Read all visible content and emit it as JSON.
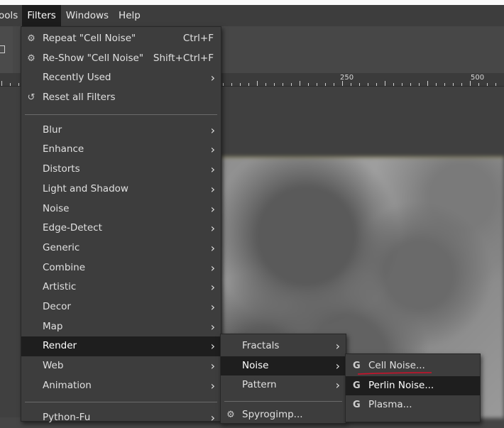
{
  "menubar": {
    "items": [
      "ools",
      "Filters",
      "Windows",
      "Help"
    ]
  },
  "ruler": {
    "labels": [
      "250",
      "500"
    ]
  },
  "filters_menu": {
    "top_items": [
      {
        "label": "Repeat \"Cell Noise\"",
        "accel": "Ctrl+F",
        "icon": "repeat-filter-icon"
      },
      {
        "label": "Re-Show \"Cell Noise\"",
        "accel": "Shift+Ctrl+F",
        "icon": "reshow-filter-icon"
      },
      {
        "label": "Recently Used",
        "submenu": true
      },
      {
        "label": "Reset all Filters",
        "icon": "reset-icon"
      }
    ],
    "categories": [
      "Blur",
      "Enhance",
      "Distorts",
      "Light and Shadow",
      "Noise",
      "Edge-Detect",
      "Generic",
      "Combine",
      "Artistic",
      "Decor",
      "Map",
      "Render",
      "Web",
      "Animation"
    ],
    "highlighted": "Render",
    "bottom_items": [
      "Python-Fu"
    ]
  },
  "render_menu": {
    "items": [
      "Fractals",
      "Noise",
      "Pattern"
    ],
    "highlighted": "Noise",
    "bottom_items": [
      "Spyrogimp..."
    ]
  },
  "noise_menu": {
    "items": [
      "Cell Noise...",
      "Perlin Noise...",
      "Plasma..."
    ],
    "highlighted": "Perlin Noise..."
  },
  "colors": {
    "menu_bg": "#3d3d3d",
    "highlight_bg": "#1e1e1e",
    "marker": "#d0102a",
    "selection_dash": "#e6d24a"
  }
}
